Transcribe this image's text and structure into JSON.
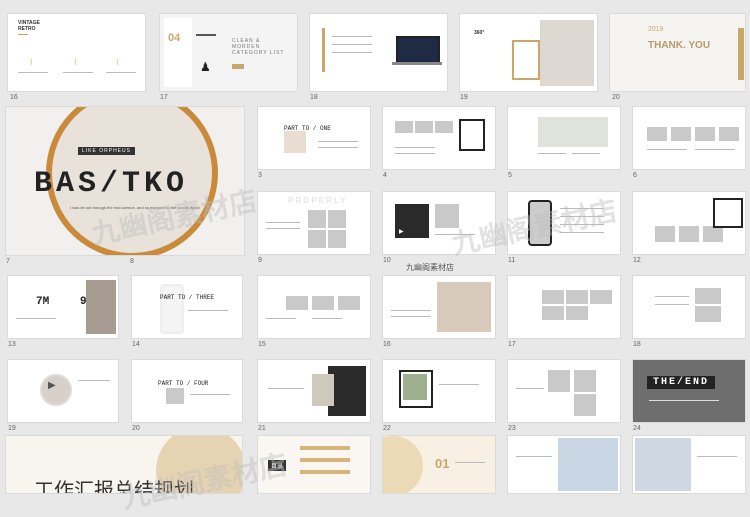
{
  "slide_numbers": [
    "16",
    "17",
    "18",
    "19",
    "20",
    "7",
    "8",
    "3",
    "4",
    "5",
    "6",
    "9",
    "10",
    "11",
    "12",
    "13",
    "14",
    "15",
    "16",
    "17",
    "18",
    "19",
    "20",
    "21",
    "22",
    "23",
    "24"
  ],
  "s16": {
    "title_line1": "VINTAGE",
    "title_line2": "RETRO"
  },
  "s17": {
    "number": "04",
    "heading_line1": "CLEAN &",
    "heading_line2": "MORDEN",
    "heading_line3": "CATEGORY LIST"
  },
  "s19": {
    "badge": "360°"
  },
  "s20": {
    "year": "2019",
    "title": "THANK. YOU"
  },
  "hero": {
    "subtitle": "LIKE ORPHEUS",
    "title": "BAS/TKO",
    "caption": "I was let out through the real avenue, and so escaped to the woods again"
  },
  "s3": {
    "title": "PART TO / ONE"
  },
  "s9": {
    "ghost": "PROPERLY"
  },
  "s14": {
    "title": "PART TO / THREE"
  },
  "s13": {
    "stat1": "7M",
    "stat2": "9W"
  },
  "s20b": {
    "title": "PART TO / FOUR"
  },
  "s24": {
    "title": "THE/END"
  },
  "bottom": {
    "left_heading": "工作汇报总结规划",
    "badge": "目录",
    "num": "01"
  },
  "watermark": {
    "text1": "九幽阁素材店",
    "label": "九幽阁素材店"
  }
}
